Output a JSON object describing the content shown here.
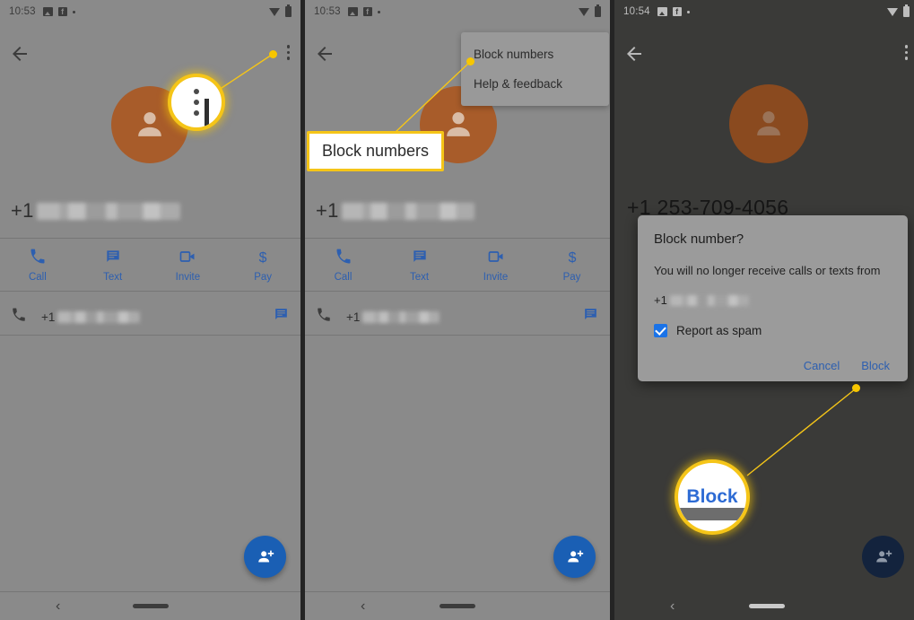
{
  "panels": [
    {
      "id": "panel-menu-closed",
      "status": {
        "time": "10:53",
        "icons": [
          "image-icon",
          "facebook-icon",
          "dot-icon",
          "wifi-icon",
          "battery-icon"
        ]
      },
      "appbar": {
        "back": "back-arrow-icon",
        "overflow": "overflow-menu-icon"
      },
      "contact": {
        "avatar": "person-avatar-icon",
        "number_prefix": "+1",
        "number_redacted": true
      },
      "actions": [
        {
          "label": "Call",
          "icon": "phone-icon"
        },
        {
          "label": "Text",
          "icon": "message-icon"
        },
        {
          "label": "Invite",
          "icon": "video-camera-icon"
        },
        {
          "label": "Pay",
          "icon": "dollar-icon"
        }
      ],
      "history_row": {
        "icon": "phone-icon",
        "number_prefix": "+1",
        "trailing_icon": "message-icon"
      },
      "fab": {
        "icon": "add-person-icon"
      },
      "navbar": {
        "back": "‹",
        "pill": "home-pill"
      }
    },
    {
      "id": "panel-menu-open",
      "status": {
        "time": "10:53"
      },
      "menu": {
        "items": [
          {
            "label": "Block numbers",
            "highlighted": true
          },
          {
            "label": "Help & feedback",
            "highlighted": false
          }
        ]
      },
      "callout": {
        "text": "Block numbers"
      },
      "contact": {
        "number_prefix": "+1"
      },
      "actions": [
        {
          "label": "Call",
          "icon": "phone-icon"
        },
        {
          "label": "Text",
          "icon": "message-icon"
        },
        {
          "label": "Invite",
          "icon": "video-camera-icon"
        },
        {
          "label": "Pay",
          "icon": "dollar-icon"
        }
      ],
      "history_row": {
        "number_prefix": "+1"
      }
    },
    {
      "id": "panel-block-dialog",
      "status": {
        "time": "10:54"
      },
      "contact": {
        "number": "+1 253-709-4056"
      },
      "dialog": {
        "title": "Block number?",
        "body": "You will no longer receive calls or texts from",
        "number_prefix": "+1",
        "checkbox": {
          "label": "Report as spam",
          "checked": true
        },
        "cancel_label": "Cancel",
        "confirm_label": "Block"
      },
      "magnifier": {
        "label": "Block"
      }
    }
  ],
  "colors": {
    "highlight": "#f5c518",
    "accent_blue": "#2d5fb0",
    "fab_blue": "#1a5fb4",
    "avatar_brown": "#a85c2a",
    "panel_bg": "#8a8a8a",
    "panel_bg_dark": "#3a3a38",
    "checkbox_blue": "#1a73e8"
  }
}
